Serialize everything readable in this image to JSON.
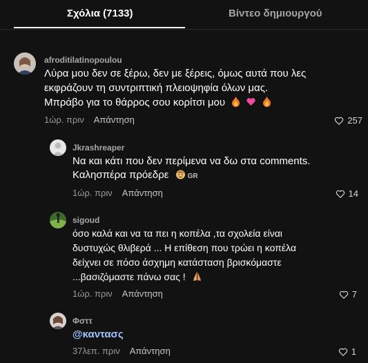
{
  "tabs": {
    "comments": "Σχόλια (7133)",
    "creator_videos": "Βίντεο δημιουργού"
  },
  "reply_label": "Απάντηση",
  "comments": [
    {
      "username": "afroditilatinopoulou",
      "lines": [
        "Λύρα μου δεν σε ξέρω, δεν με ξέρεις, όμως αυτά που λες",
        "εκφράζουν τη συντριπτική πλειοψηφία όλων μας.",
        "Μπράβο για το θάρρος σου κορίτσι μου"
      ],
      "emojis": [
        "fire-emoji",
        "pink-heart-emoji",
        "fire-emoji"
      ],
      "time": "1ώρ. πριν",
      "likes": "257"
    },
    {
      "username": "Jkrashreaper",
      "lines": [
        "Να και κάτι που δεν περίμενα να δω στα comments.",
        "Καλησπέρα πρόεδρε"
      ],
      "emojis": [
        "face-emoji"
      ],
      "badge": "GR",
      "time": "1ώρ. πριν",
      "likes": "14"
    },
    {
      "username": "sigoud",
      "lines": [
        "όσο καλά και να τα πει η κοπέλα ,τα σχολεία είναι",
        "δυστυχώς θλιβερά ... Η επίθεση που τρώει η κοπέλα",
        "δείχνει σε πόσο άσχημη κατάσταση βρισκόμαστε",
        "...βασιζόμαστε πάνω σας !"
      ],
      "emojis": [
        "praying-hands-emoji"
      ],
      "time": "1ώρ. πριν",
      "likes": "7"
    },
    {
      "username": "Φσττ",
      "mention": "@καντασς",
      "time": "37λεπ. πριν",
      "likes": "1"
    }
  ],
  "colors": {
    "background": "#121212",
    "mention": "#9fc3ff",
    "fire": "#f07a2a",
    "pink_heart": "#f24aa0"
  }
}
